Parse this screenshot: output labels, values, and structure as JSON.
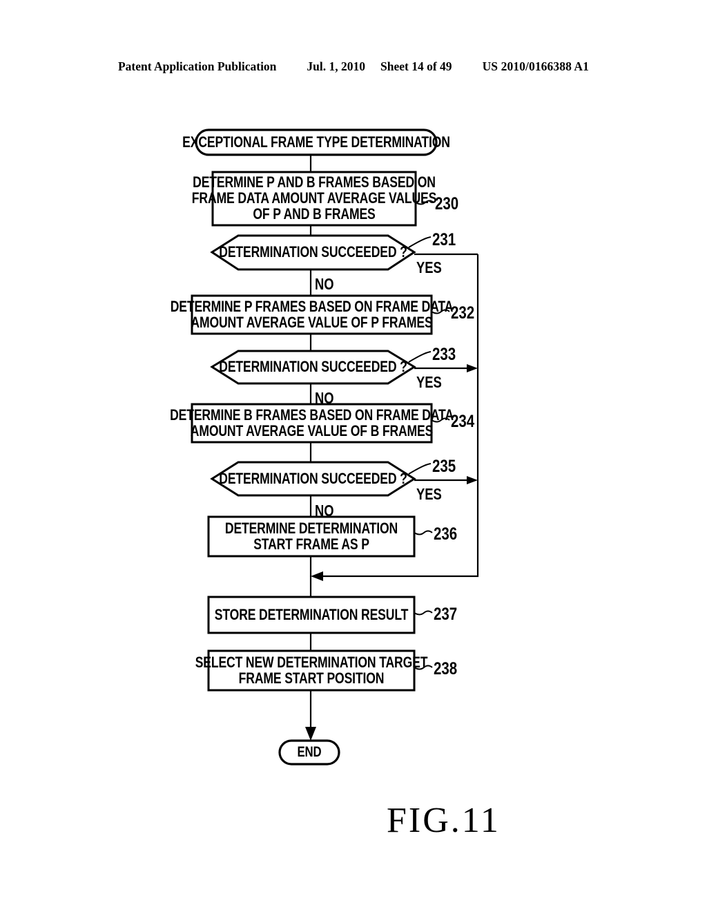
{
  "header": {
    "publication": "Patent Application Publication",
    "date": "Jul. 1, 2010",
    "sheet": "Sheet 14 of 49",
    "patent_number": "US 2010/0166388 A1"
  },
  "figure": {
    "label": "FIG.11"
  },
  "flowchart": {
    "start": {
      "id": "start-terminator",
      "text": "EXCEPTIONAL FRAME TYPE DETERMINATION"
    },
    "end": {
      "id": "end-terminator",
      "text": "END"
    },
    "steps": [
      {
        "ref": "230",
        "type": "process",
        "lines": [
          "DETERMINE P AND B FRAMES BASED ON",
          "FRAME DATA AMOUNT AVERAGE VALUES",
          "OF P AND B FRAMES"
        ]
      },
      {
        "ref": "231",
        "type": "decision",
        "lines": [
          "DETERMINATION SUCCEEDED ?"
        ],
        "yes_label": "YES",
        "no_label": "NO"
      },
      {
        "ref": "232",
        "type": "process",
        "lines": [
          "DETERMINE P FRAMES BASED ON FRAME DATA",
          "AMOUNT AVERAGE VALUE OF P FRAMES"
        ]
      },
      {
        "ref": "233",
        "type": "decision",
        "lines": [
          "DETERMINATION SUCCEEDED ?"
        ],
        "yes_label": "YES",
        "no_label": "NO"
      },
      {
        "ref": "234",
        "type": "process",
        "lines": [
          "DETERMINE B FRAMES BASED ON FRAME DATA",
          "AMOUNT AVERAGE VALUE OF B FRAMES"
        ]
      },
      {
        "ref": "235",
        "type": "decision",
        "lines": [
          "DETERMINATION SUCCEEDED ?"
        ],
        "yes_label": "YES",
        "no_label": "NO"
      },
      {
        "ref": "236",
        "type": "process",
        "lines": [
          "DETERMINE DETERMINATION",
          "START FRAME AS P"
        ]
      },
      {
        "ref": "237",
        "type": "process",
        "lines": [
          "STORE DETERMINATION RESULT"
        ]
      },
      {
        "ref": "238",
        "type": "process",
        "lines": [
          "SELECT NEW DETERMINATION TARGET",
          "FRAME START POSITION"
        ]
      }
    ]
  },
  "colors": {
    "ink": "#000000",
    "paper": "#ffffff"
  }
}
